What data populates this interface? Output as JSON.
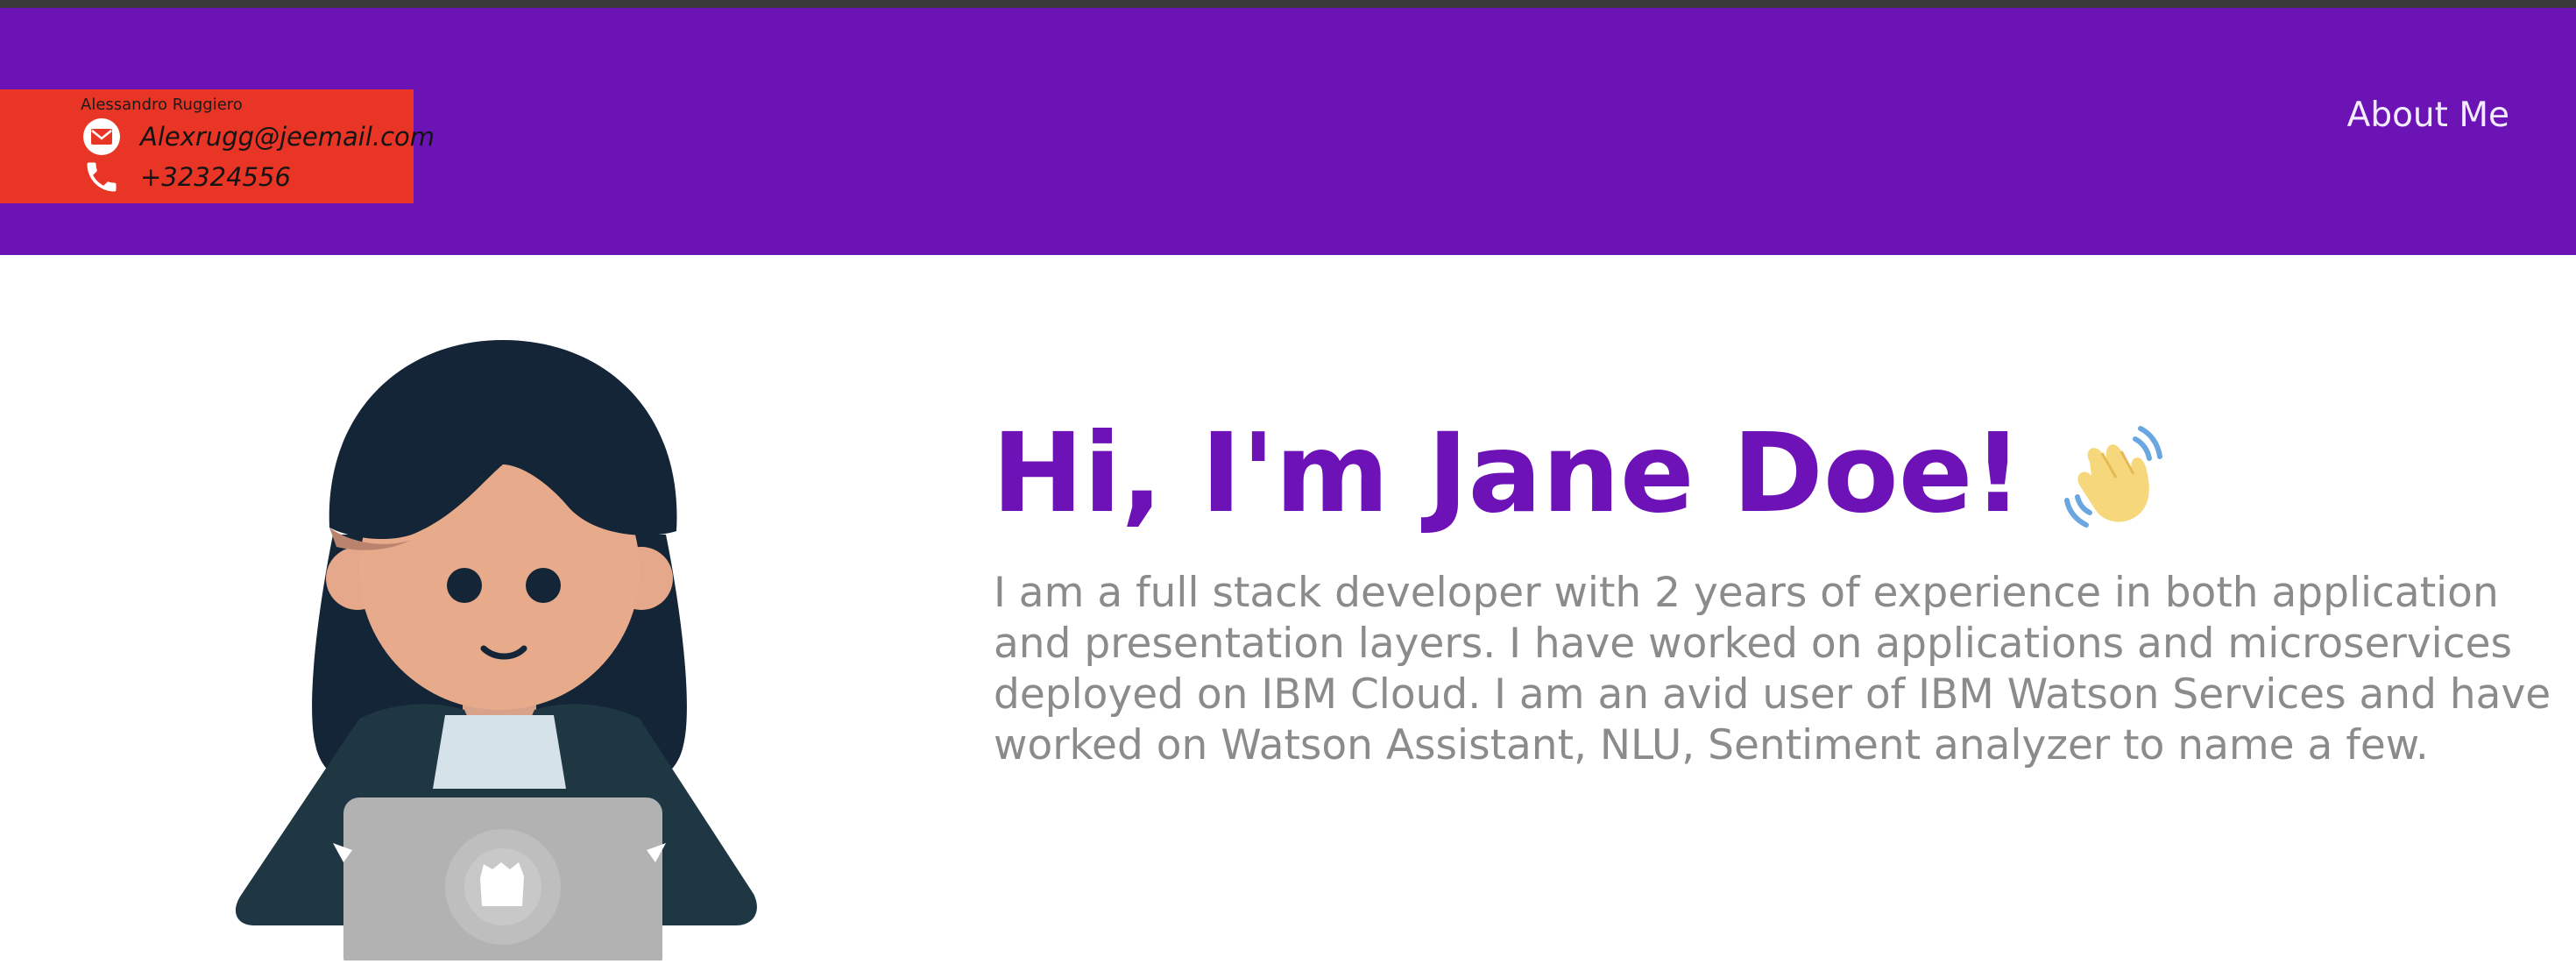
{
  "contact": {
    "name": "Alessandro Ruggiero",
    "email": "Alexrugg@jeemail.com",
    "phone": "+32324556",
    "email_icon": "mail-icon",
    "phone_icon": "phone-icon"
  },
  "nav": {
    "about_label": "About Me"
  },
  "hero": {
    "title": "Hi, I'm Jane Doe!",
    "title_icon": "waving-hand-icon",
    "description": "I am a full stack developer with 2 years of experience in both application and presentation layers. I have worked on applications and microservices deployed on IBM Cloud. I am an avid user of IBM Watson Services and have worked on Watson Assistant, NLU, Sentiment analyzer to name a few."
  },
  "colors": {
    "header_bg": "#6b13b5",
    "contact_bg": "#e83526",
    "title_color": "#6d12b7",
    "text_gray": "#8b8b8b"
  }
}
